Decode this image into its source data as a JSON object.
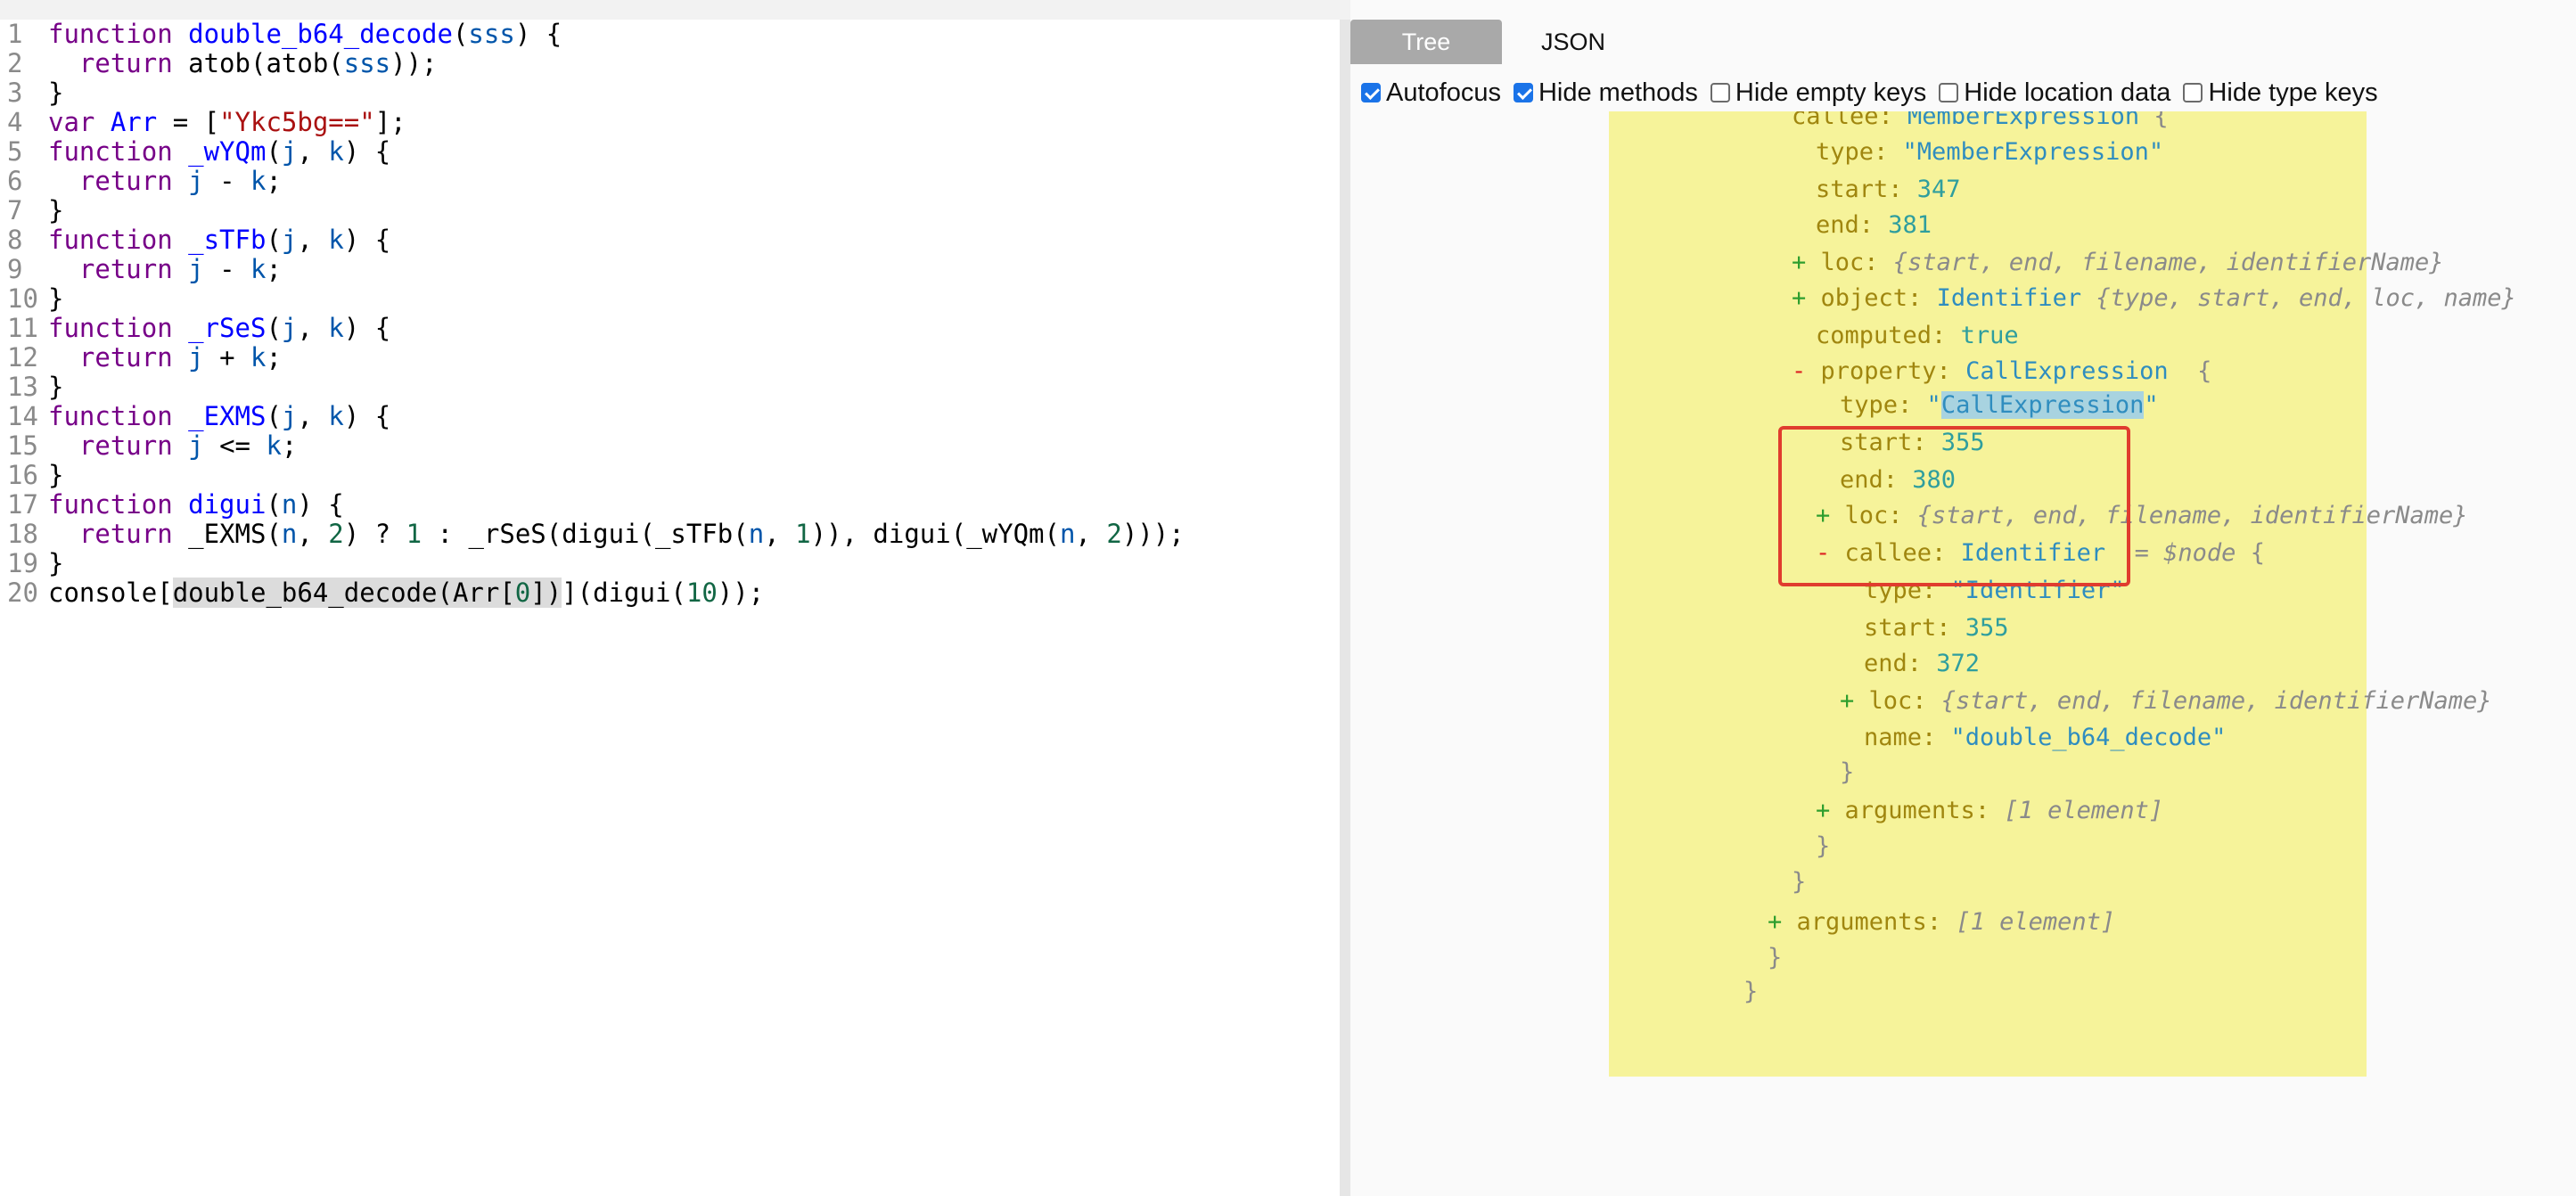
{
  "editor": {
    "lines": [
      {
        "n": "1",
        "tokens": [
          {
            "c": "kw",
            "t": "function "
          },
          {
            "c": "def",
            "t": "double_b64_decode"
          },
          {
            "c": "plain",
            "t": "("
          },
          {
            "c": "var2",
            "t": "sss"
          },
          {
            "c": "plain",
            "t": ") {"
          }
        ]
      },
      {
        "n": "2",
        "tokens": [
          {
            "c": "plain",
            "t": "  "
          },
          {
            "c": "kw",
            "t": "return "
          },
          {
            "c": "plain",
            "t": "atob(atob("
          },
          {
            "c": "var2",
            "t": "sss"
          },
          {
            "c": "plain",
            "t": "));"
          }
        ]
      },
      {
        "n": "3",
        "tokens": [
          {
            "c": "plain",
            "t": "}"
          }
        ]
      },
      {
        "n": "4",
        "tokens": [
          {
            "c": "kw",
            "t": "var "
          },
          {
            "c": "def",
            "t": "Arr"
          },
          {
            "c": "plain",
            "t": " = ["
          },
          {
            "c": "str",
            "t": "\"Ykc5bg==\""
          },
          {
            "c": "plain",
            "t": "];"
          }
        ]
      },
      {
        "n": "5",
        "tokens": [
          {
            "c": "kw",
            "t": "function "
          },
          {
            "c": "def",
            "t": "_wYQm"
          },
          {
            "c": "plain",
            "t": "("
          },
          {
            "c": "var2",
            "t": "j"
          },
          {
            "c": "plain",
            "t": ", "
          },
          {
            "c": "var2",
            "t": "k"
          },
          {
            "c": "plain",
            "t": ") {"
          }
        ]
      },
      {
        "n": "6",
        "tokens": [
          {
            "c": "plain",
            "t": "  "
          },
          {
            "c": "kw",
            "t": "return "
          },
          {
            "c": "var2",
            "t": "j"
          },
          {
            "c": "plain",
            "t": " - "
          },
          {
            "c": "var2",
            "t": "k"
          },
          {
            "c": "plain",
            "t": ";"
          }
        ]
      },
      {
        "n": "7",
        "tokens": [
          {
            "c": "plain",
            "t": "}"
          }
        ]
      },
      {
        "n": "8",
        "tokens": [
          {
            "c": "kw",
            "t": "function "
          },
          {
            "c": "def",
            "t": "_sTFb"
          },
          {
            "c": "plain",
            "t": "("
          },
          {
            "c": "var2",
            "t": "j"
          },
          {
            "c": "plain",
            "t": ", "
          },
          {
            "c": "var2",
            "t": "k"
          },
          {
            "c": "plain",
            "t": ") {"
          }
        ]
      },
      {
        "n": "9",
        "tokens": [
          {
            "c": "plain",
            "t": "  "
          },
          {
            "c": "kw",
            "t": "return "
          },
          {
            "c": "var2",
            "t": "j"
          },
          {
            "c": "plain",
            "t": " - "
          },
          {
            "c": "var2",
            "t": "k"
          },
          {
            "c": "plain",
            "t": ";"
          }
        ]
      },
      {
        "n": "10",
        "tokens": [
          {
            "c": "plain",
            "t": "}"
          }
        ]
      },
      {
        "n": "11",
        "tokens": [
          {
            "c": "kw",
            "t": "function "
          },
          {
            "c": "def",
            "t": "_rSeS"
          },
          {
            "c": "plain",
            "t": "("
          },
          {
            "c": "var2",
            "t": "j"
          },
          {
            "c": "plain",
            "t": ", "
          },
          {
            "c": "var2",
            "t": "k"
          },
          {
            "c": "plain",
            "t": ") {"
          }
        ]
      },
      {
        "n": "12",
        "tokens": [
          {
            "c": "plain",
            "t": "  "
          },
          {
            "c": "kw",
            "t": "return "
          },
          {
            "c": "var2",
            "t": "j"
          },
          {
            "c": "plain",
            "t": " + "
          },
          {
            "c": "var2",
            "t": "k"
          },
          {
            "c": "plain",
            "t": ";"
          }
        ]
      },
      {
        "n": "13",
        "tokens": [
          {
            "c": "plain",
            "t": "}"
          }
        ]
      },
      {
        "n": "14",
        "tokens": [
          {
            "c": "kw",
            "t": "function "
          },
          {
            "c": "def",
            "t": "_EXMS"
          },
          {
            "c": "plain",
            "t": "("
          },
          {
            "c": "var2",
            "t": "j"
          },
          {
            "c": "plain",
            "t": ", "
          },
          {
            "c": "var2",
            "t": "k"
          },
          {
            "c": "plain",
            "t": ") {"
          }
        ]
      },
      {
        "n": "15",
        "tokens": [
          {
            "c": "plain",
            "t": "  "
          },
          {
            "c": "kw",
            "t": "return "
          },
          {
            "c": "var2",
            "t": "j"
          },
          {
            "c": "plain",
            "t": " <= "
          },
          {
            "c": "var2",
            "t": "k"
          },
          {
            "c": "plain",
            "t": ";"
          }
        ]
      },
      {
        "n": "16",
        "tokens": [
          {
            "c": "plain",
            "t": "}"
          }
        ]
      },
      {
        "n": "17",
        "tokens": [
          {
            "c": "kw",
            "t": "function "
          },
          {
            "c": "def",
            "t": "digui"
          },
          {
            "c": "plain",
            "t": "("
          },
          {
            "c": "var2",
            "t": "n"
          },
          {
            "c": "plain",
            "t": ") {"
          }
        ]
      },
      {
        "n": "18",
        "tokens": [
          {
            "c": "plain",
            "t": "  "
          },
          {
            "c": "kw",
            "t": "return "
          },
          {
            "c": "plain",
            "t": "_EXMS("
          },
          {
            "c": "var2",
            "t": "n"
          },
          {
            "c": "plain",
            "t": ", "
          },
          {
            "c": "num",
            "t": "2"
          },
          {
            "c": "plain",
            "t": ") ? "
          },
          {
            "c": "num",
            "t": "1"
          },
          {
            "c": "plain",
            "t": " : _rSeS(digui(_sTFb("
          },
          {
            "c": "var2",
            "t": "n"
          },
          {
            "c": "plain",
            "t": ", "
          },
          {
            "c": "num",
            "t": "1"
          },
          {
            "c": "plain",
            "t": ")), digui(_wYQm("
          },
          {
            "c": "var2",
            "t": "n"
          },
          {
            "c": "plain",
            "t": ", "
          },
          {
            "c": "num",
            "t": "2"
          },
          {
            "c": "plain",
            "t": ")));"
          }
        ]
      },
      {
        "n": "19",
        "tokens": [
          {
            "c": "plain",
            "t": "}"
          }
        ]
      },
      {
        "n": "20",
        "tokens": [
          {
            "c": "plain",
            "t": "console["
          },
          {
            "c": "hl",
            "t": "double_b64_decode(Arr["
          },
          {
            "c": "num hl",
            "t": "0"
          },
          {
            "c": "hl",
            "t": "])"
          },
          {
            "c": "plain",
            "t": "](digui("
          },
          {
            "c": "num",
            "t": "10"
          },
          {
            "c": "plain",
            "t": "));"
          }
        ]
      }
    ]
  },
  "panel": {
    "tabs": {
      "tree": "Tree",
      "json": "JSON"
    },
    "options": [
      {
        "label": "Autofocus",
        "checked": true
      },
      {
        "label": "Hide methods",
        "checked": true
      },
      {
        "label": "Hide empty keys",
        "checked": false
      },
      {
        "label": "Hide location data",
        "checked": false
      },
      {
        "label": "Hide type keys",
        "checked": false
      }
    ]
  },
  "tree": {
    "rows": [
      {
        "i": 0,
        "parts": [
          {
            "c": "key",
            "t": "callee: "
          },
          {
            "c": "t-type",
            "t": "MemberExpression"
          },
          {
            "c": "brace",
            "t": " {"
          }
        ]
      },
      {
        "i": 1,
        "parts": [
          {
            "c": "key",
            "t": "type: "
          },
          {
            "c": "t-str",
            "t": "\"MemberExpression\""
          }
        ]
      },
      {
        "i": 1,
        "parts": [
          {
            "c": "key",
            "t": "start: "
          },
          {
            "c": "t-num",
            "t": "347"
          }
        ]
      },
      {
        "i": 1,
        "parts": [
          {
            "c": "key",
            "t": "end: "
          },
          {
            "c": "t-num",
            "t": "381"
          }
        ]
      },
      {
        "i": 0,
        "parts": [
          {
            "c": "toggle-plus",
            "t": "+ "
          },
          {
            "c": "key",
            "t": "loc: "
          },
          {
            "c": "summary",
            "t": "{start, end, filename, identifierName}"
          }
        ]
      },
      {
        "i": 0,
        "parts": [
          {
            "c": "toggle-plus",
            "t": "+ "
          },
          {
            "c": "key",
            "t": "object: "
          },
          {
            "c": "t-type",
            "t": "Identifier "
          },
          {
            "c": "summary",
            "t": "{type, start, end, loc, name}"
          }
        ]
      },
      {
        "i": 1,
        "parts": [
          {
            "c": "key",
            "t": "computed: "
          },
          {
            "c": "t-bool",
            "t": "true"
          }
        ]
      },
      {
        "i": 0,
        "parts": [
          {
            "c": "toggle-minus",
            "t": "- "
          },
          {
            "c": "key",
            "t": "property: "
          },
          {
            "c": "t-type",
            "t": "CallExpression"
          },
          {
            "c": "brace",
            "t": "  {"
          }
        ]
      },
      {
        "i": 2,
        "parts": [
          {
            "c": "key",
            "t": "type: "
          },
          {
            "c": "t-str",
            "t": "\""
          },
          {
            "c": "t-str sel",
            "t": "CallExpression"
          },
          {
            "c": "t-str",
            "t": "\""
          }
        ]
      },
      {
        "i": 2,
        "parts": [
          {
            "c": "key",
            "t": "start: "
          },
          {
            "c": "t-num",
            "t": "355"
          }
        ]
      },
      {
        "i": 2,
        "parts": [
          {
            "c": "key",
            "t": "end: "
          },
          {
            "c": "t-num",
            "t": "380"
          }
        ]
      },
      {
        "i": 1,
        "parts": [
          {
            "c": "toggle-plus",
            "t": "+ "
          },
          {
            "c": "key",
            "t": "loc: "
          },
          {
            "c": "summary",
            "t": "{start, end, filename, identifierName}"
          }
        ]
      },
      {
        "i": 1,
        "parts": [
          {
            "c": "toggle-minus",
            "t": "- "
          },
          {
            "c": "key",
            "t": "callee: "
          },
          {
            "c": "t-type",
            "t": "Identifier"
          },
          {
            "c": "summary",
            "t": "  = $node "
          },
          {
            "c": "brace",
            "t": "{"
          }
        ]
      },
      {
        "i": 3,
        "parts": [
          {
            "c": "key",
            "t": "type: "
          },
          {
            "c": "t-str",
            "t": "\"Identifier\""
          }
        ]
      },
      {
        "i": 3,
        "parts": [
          {
            "c": "key",
            "t": "start: "
          },
          {
            "c": "t-num",
            "t": "355"
          }
        ]
      },
      {
        "i": 3,
        "parts": [
          {
            "c": "key",
            "t": "end: "
          },
          {
            "c": "t-num",
            "t": "372"
          }
        ]
      },
      {
        "i": 2,
        "parts": [
          {
            "c": "toggle-plus",
            "t": "+ "
          },
          {
            "c": "key",
            "t": "loc: "
          },
          {
            "c": "summary",
            "t": "{start, end, filename, identifierName}"
          }
        ]
      },
      {
        "i": 3,
        "parts": [
          {
            "c": "key",
            "t": "name: "
          },
          {
            "c": "t-str",
            "t": "\"double_b64_decode\""
          }
        ]
      },
      {
        "i": 2,
        "parts": [
          {
            "c": "brace",
            "t": "}"
          }
        ]
      },
      {
        "i": 1,
        "parts": [
          {
            "c": "toggle-plus",
            "t": "+ "
          },
          {
            "c": "key",
            "t": "arguments: "
          },
          {
            "c": "summary",
            "t": "[1 element]"
          }
        ]
      },
      {
        "i": 1,
        "parts": [
          {
            "c": "brace",
            "t": "}"
          }
        ]
      },
      {
        "i": 0,
        "parts": [
          {
            "c": "brace",
            "t": "}"
          }
        ]
      },
      {
        "i": -1,
        "parts": [
          {
            "c": "toggle-plus",
            "t": "+ "
          },
          {
            "c": "key",
            "t": "arguments: "
          },
          {
            "c": "summary",
            "t": "[1 element]"
          }
        ]
      },
      {
        "i": -1,
        "parts": [
          {
            "c": "brace",
            "t": "}"
          }
        ]
      },
      {
        "i": -2,
        "parts": [
          {
            "c": "brace",
            "t": "}"
          }
        ]
      }
    ]
  }
}
